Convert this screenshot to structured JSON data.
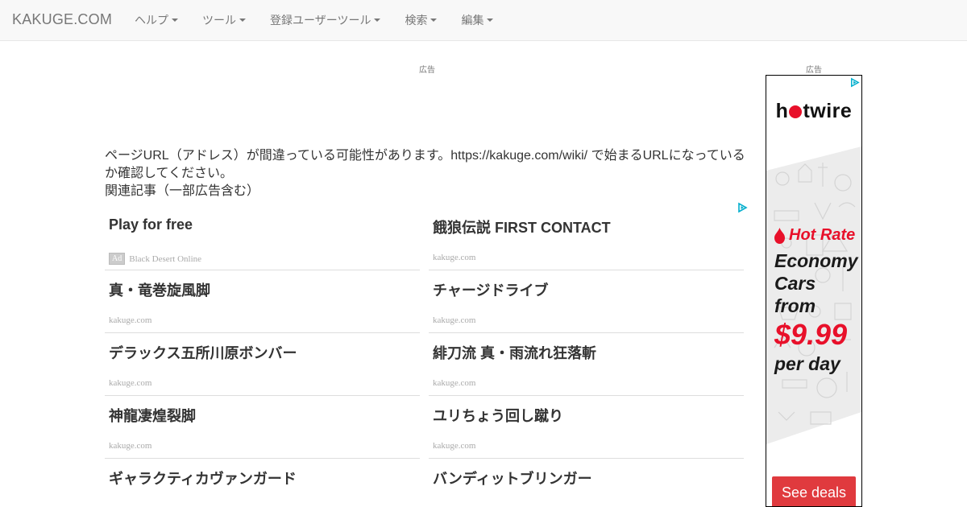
{
  "navbar": {
    "brand": "KAKUGE.COM",
    "menu": [
      {
        "label": "ヘルプ"
      },
      {
        "label": "ツール"
      },
      {
        "label": "登録ユーザーツール"
      },
      {
        "label": "検索"
      },
      {
        "label": "編集"
      }
    ]
  },
  "ads": {
    "top_label": "広告",
    "side_label": "広告"
  },
  "message": {
    "line1": "ページURL（アドレス）が間違っている可能性があります。https://kakuge.com/wiki/ で始まるURLになっているか確認してください。",
    "related": "関連記事（一部広告含む）"
  },
  "related": {
    "left": [
      {
        "title": "Play for free",
        "source": "Black Desert Online",
        "sponsored": true,
        "badge": "Ad"
      },
      {
        "title": "真・竜巻旋風脚",
        "source": "kakuge.com"
      },
      {
        "title": "デラックス五所川原ボンバー",
        "source": "kakuge.com"
      },
      {
        "title": "神龍凄煌裂脚",
        "source": "kakuge.com"
      },
      {
        "title": "ギャラクティカヴァンガード",
        "source": ""
      }
    ],
    "right": [
      {
        "title": "餓狼伝説 FIRST CONTACT",
        "source": "kakuge.com"
      },
      {
        "title": "チャージドライブ",
        "source": "kakuge.com"
      },
      {
        "title": "緋刀流 真・雨流れ狂落斬",
        "source": "kakuge.com"
      },
      {
        "title": "ユリちょう回し蹴り",
        "source": "kakuge.com"
      },
      {
        "title": "バンディットブリンガー",
        "source": ""
      }
    ]
  },
  "side_ad": {
    "brand": "hotwire",
    "brand_pre": "h",
    "brand_post": "twire",
    "hot_rate": "Hot Rate",
    "line1": "Economy",
    "line2": "Cars",
    "line3": "from",
    "price": "$9.99",
    "line4": "per day",
    "cta": "See deals",
    "colors": {
      "accent": "#e8102a",
      "cta": "#e03a3e"
    }
  },
  "icons": [
    "caret-down-icon",
    "adchoices-icon",
    "flame-icon"
  ]
}
